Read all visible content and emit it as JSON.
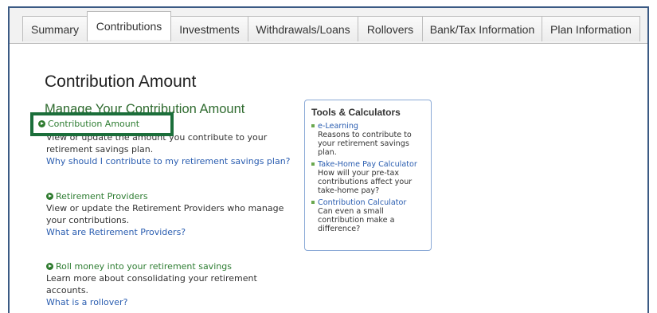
{
  "tabs": [
    {
      "label": "Summary",
      "active": false
    },
    {
      "label": "Contributions",
      "active": true
    },
    {
      "label": "Investments",
      "active": false
    },
    {
      "label": "Withdrawals/Loans",
      "active": false
    },
    {
      "label": "Rollovers",
      "active": false
    },
    {
      "label": "Bank/Tax Information",
      "active": false
    },
    {
      "label": "Plan Information",
      "active": false
    }
  ],
  "page_title": "Contribution Amount",
  "section_title": "Manage Your Contribution Amount",
  "items": [
    {
      "link": "Contribution Amount",
      "desc_line1": "View or update the amount you contribute to your",
      "desc_line2": "retirement savings plan.",
      "help": "Why should I contribute to my retirement savings plan?"
    },
    {
      "link": "Retirement Providers",
      "desc_line1": "View or update the Retirement Providers who manage",
      "desc_line2": "your contributions.",
      "help": "What are Retirement Providers?"
    },
    {
      "link": "Roll money into your retirement savings",
      "desc_line1": "Learn more about consolidating your retirement",
      "desc_line2": "accounts.",
      "help": "What is a rollover?"
    }
  ],
  "tools": {
    "title": "Tools & Calculators",
    "items": [
      {
        "link": "e-Learning",
        "desc": [
          "Reasons to contribute to",
          "your retirement savings",
          "plan."
        ]
      },
      {
        "link": "Take-Home Pay Calculator",
        "desc": [
          "How will your pre-tax",
          "contributions affect your",
          "take-home pay?"
        ]
      },
      {
        "link": "Contribution Calculator",
        "desc": [
          "Can even a small",
          "contribution make a",
          "difference?"
        ]
      }
    ]
  },
  "colors": {
    "frame_border": "#3b5a84",
    "section_green": "#2f6b2f",
    "highlight_green": "#1b6e3a",
    "link_blue": "#2a5db0"
  }
}
